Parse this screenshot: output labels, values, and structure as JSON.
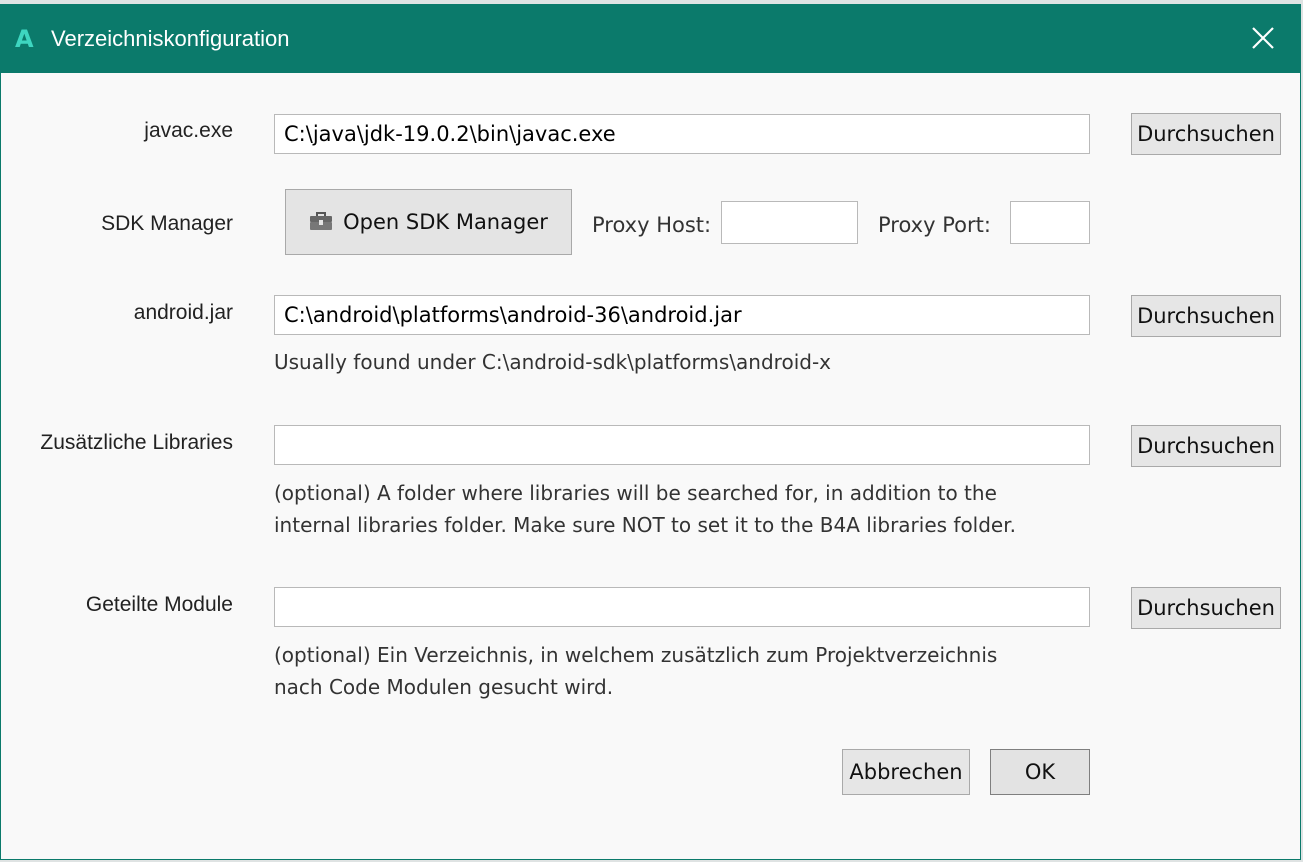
{
  "window": {
    "title": "Verzeichniskonfiguration",
    "app_icon": "A",
    "close_icon": "close-icon"
  },
  "javac": {
    "label": "javac.exe",
    "value": "C:\\java\\jdk-19.0.2\\bin\\javac.exe",
    "browse_label": "Durchsuchen"
  },
  "sdk": {
    "label": "SDK Manager",
    "button_label": "Open SDK Manager",
    "button_icon": "toolbox-icon",
    "proxy_host_label": "Proxy Host:",
    "proxy_host_value": "",
    "proxy_port_label": "Proxy Port:",
    "proxy_port_value": ""
  },
  "android_jar": {
    "label": "android.jar",
    "value": "C:\\android\\platforms\\android-36\\android.jar",
    "browse_label": "Durchsuchen",
    "hint": "Usually found under C:\\android-sdk\\platforms\\android-x"
  },
  "libraries": {
    "label": "Zusätzliche Libraries",
    "value": "",
    "browse_label": "Durchsuchen",
    "hint_line1": "(optional) A folder where libraries will be searched for, in addition to the",
    "hint_line2": "internal libraries folder. Make sure NOT to set it to the B4A libraries folder."
  },
  "modules": {
    "label": "Geteilte Module",
    "value": "",
    "browse_label": "Durchsuchen",
    "hint_line1": "(optional) Ein Verzeichnis, in welchem zusätzlich zum Projektverzeichnis",
    "hint_line2": "nach Code Modulen gesucht wird."
  },
  "footer": {
    "cancel_label": "Abbrechen",
    "ok_label": "OK"
  },
  "colors": {
    "titlebar": "#0b7a6b",
    "app_icon": "#3ed6c0",
    "background": "#f9f9f9"
  }
}
